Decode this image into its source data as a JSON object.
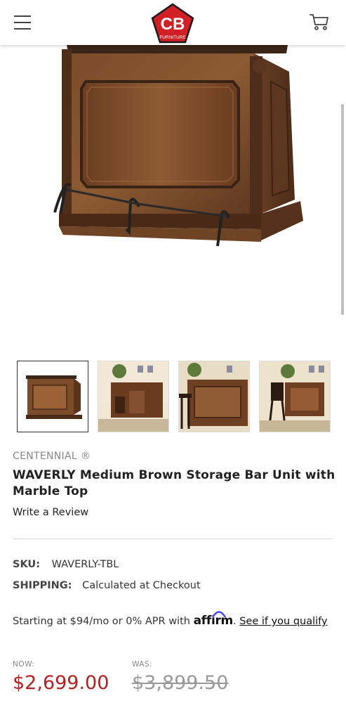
{
  "header": {
    "logo_text": "CB",
    "logo_subtext": "FURNITURE",
    "menu_icon": "hamburger-menu-icon",
    "cart_icon": "shopping-cart-icon",
    "brand_color": "#d21f26"
  },
  "gallery": {
    "thumbnail_count": 4,
    "active_index": 0
  },
  "product": {
    "brand": "CENTENNIAL ®",
    "title": "WAVERLY Medium Brown Storage Bar Unit with Marble Top",
    "review_link": "Write a Review",
    "sku_label": "SKU:",
    "sku_value": "WAVERLY-TBL",
    "shipping_label": "SHIPPING:",
    "shipping_value": "Calculated at Checkout"
  },
  "financing": {
    "prefix": "Starting at $94/mo or 0% APR with",
    "provider": "affirm",
    "period": ".",
    "link": "See if you qualify",
    "accent": "#4a4af4"
  },
  "pricing": {
    "now_label": "NOW:",
    "now_price": "$2,699.00",
    "was_label": "WAS:",
    "was_price": "$3,899.50",
    "sale_color": "#b22020"
  }
}
